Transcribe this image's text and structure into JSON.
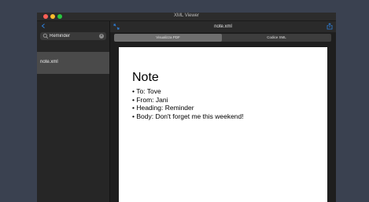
{
  "window": {
    "title": "XML Viewer"
  },
  "sidebar": {
    "search": {
      "value": "Reminder"
    },
    "files": [
      {
        "label": "note.xml"
      }
    ]
  },
  "main": {
    "title": "note.xml",
    "tabs": [
      {
        "label": "Visualizza PDF",
        "selected": true
      },
      {
        "label": "Codice XML",
        "selected": false
      }
    ],
    "document": {
      "heading": "Note",
      "items": [
        "To: Tove",
        "From: Jani",
        "Heading: Reminder",
        "Body: Don't forget me this weekend!"
      ]
    }
  },
  "colors": {
    "accent": "#2f7fd9",
    "desktop": "#3a4150",
    "sidebar_bg": "#262626",
    "selected_item": "#4a4a4a"
  },
  "icons": [
    "sidebar-toggle-icon",
    "search-icon",
    "clear-icon",
    "expand-icon",
    "share-icon"
  ]
}
